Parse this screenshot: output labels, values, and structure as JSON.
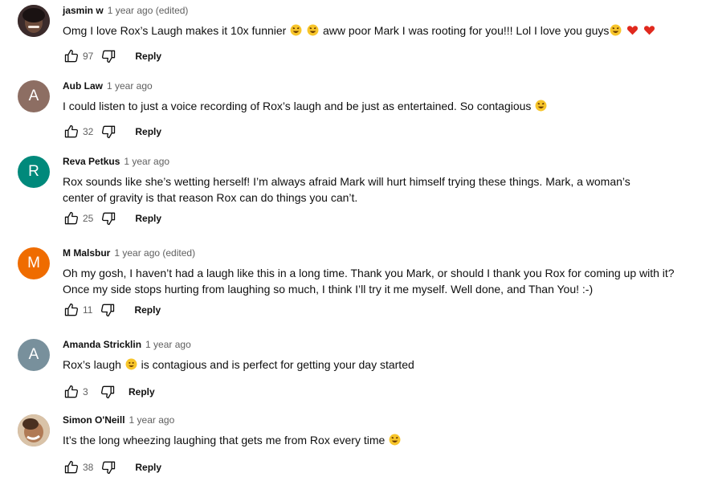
{
  "comments": [
    {
      "author": "jasmin w",
      "time": "1 year ago (edited)",
      "avatar_type": "photo",
      "avatar_color": "#3b2b2b",
      "text_lines": [
        "Omg I love Rox’s Laugh makes it 10x funnier 😂 😂  aww poor Mark I was rooting for you!!! Lol I love you guys😂 ❤️ ❤️"
      ],
      "likes": "97",
      "reply_label": "Reply"
    },
    {
      "author": "Aub Law",
      "time": "1 year ago",
      "avatar_type": "letter",
      "avatar_letter": "A",
      "avatar_color": "#8d6e63",
      "text_lines": [
        "I could listen to just a voice recording of Rox’s laugh and be just as entertained. So contagious 😆"
      ],
      "likes": "32",
      "reply_label": "Reply"
    },
    {
      "author": "Reva Petkus",
      "time": "1 year ago",
      "avatar_type": "letter",
      "avatar_letter": "R",
      "avatar_color": "#00897b",
      "text_lines": [
        "Rox sounds like she’s wetting herself!  I’m always afraid Mark will hurt himself trying these things.   Mark, a woman’s",
        "center of gravity is that reason Rox can do things you can’t."
      ],
      "likes": "25",
      "reply_label": "Reply"
    },
    {
      "author": "M Malsbur",
      "time": "1 year ago (edited)",
      "avatar_type": "letter",
      "avatar_letter": "M",
      "avatar_color": "#ef6c00",
      "text_lines": [
        "Oh my gosh, I haven’t had a laugh like this in a long time.  Thank you Mark, or should I thank you Rox for coming up with it?",
        "Once my side stops hurting from laughing so much, I think I’ll try it me myself.  Well done, and Than You!  :-)"
      ],
      "likes": "11",
      "reply_label": "Reply"
    },
    {
      "author": "Amanda Stricklin",
      "time": "1 year ago",
      "avatar_type": "letter",
      "avatar_letter": "A",
      "avatar_color": "#78909c",
      "text_lines": [
        "Rox’s laugh 😃  is contagious and is perfect for getting your day started"
      ],
      "likes": "3",
      "reply_label": "Reply"
    },
    {
      "author": "Simon O'Neill",
      "time": "1 year ago",
      "avatar_type": "photo",
      "avatar_color": "#a07858",
      "text_lines": [
        "It’s the long wheezing laughing that gets me from Rox every time 😂"
      ],
      "likes": "38",
      "reply_label": "Reply"
    }
  ],
  "icons": {
    "like": "thumbs-up-icon",
    "dislike": "thumbs-down-icon"
  }
}
